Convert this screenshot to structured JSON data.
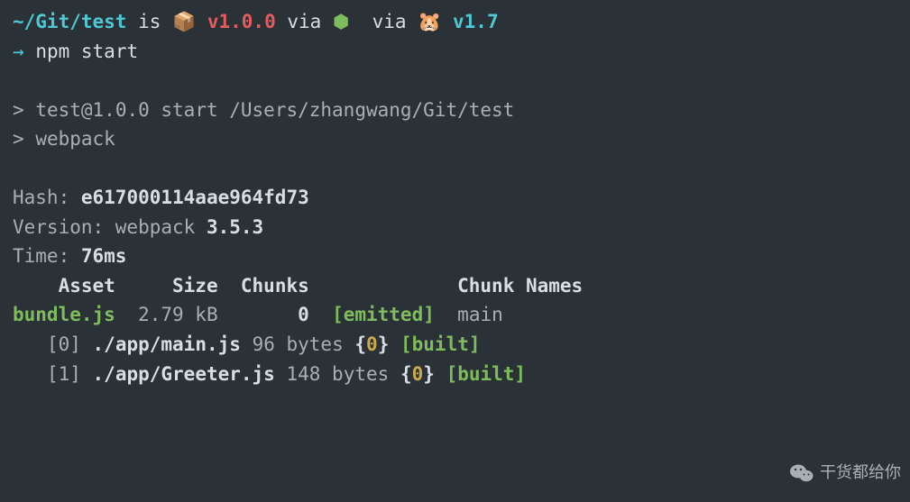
{
  "prompt": {
    "path": "~/Git/test",
    "is": "is",
    "pkg_emoji": "📦",
    "pkg_version": "v1.0.0",
    "via1": "via",
    "node_emoji": "⬢",
    "via2": "via",
    "gopher_emoji": "🐹",
    "go_version": "v1.7",
    "arrow": "→",
    "command": "npm start"
  },
  "npm": {
    "line1_prefix": ">",
    "line1": "test@1.0.0 start /Users/zhangwang/Git/test",
    "line2_prefix": ">",
    "line2": "webpack"
  },
  "webpack": {
    "hash_label": "Hash:",
    "hash": "e617000114aae964fd73",
    "version_label": "Version: webpack",
    "version": "3.5.3",
    "time_label": "Time:",
    "time": "76ms",
    "headers": {
      "asset": "Asset",
      "size": "Size",
      "chunks": "Chunks",
      "chunk_names": "Chunk Names"
    },
    "row": {
      "asset": "bundle.js",
      "size": "2.79 kB",
      "chunk": "0",
      "status": "[emitted]",
      "name": "main"
    },
    "modules": [
      {
        "idx": "[0]",
        "file": "./app/main.js",
        "bytes": "96 bytes",
        "brace_l": "{",
        "chunk": "0",
        "brace_r": "}",
        "status": "[built]"
      },
      {
        "idx": "[1]",
        "file": "./app/Greeter.js",
        "bytes": "148 bytes",
        "brace_l": "{",
        "chunk": "0",
        "brace_r": "}",
        "status": "[built]"
      }
    ]
  },
  "watermark": {
    "text": "干货都给你"
  }
}
